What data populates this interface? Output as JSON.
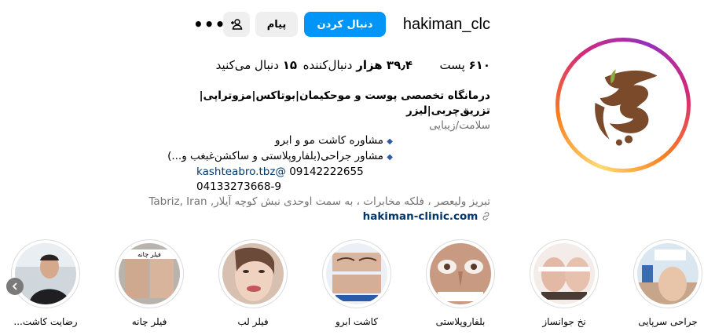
{
  "profile": {
    "username": "hakiman_clc",
    "follow_label": "دنبال کردن",
    "message_label": "پیام",
    "more_label": "•••",
    "stats": {
      "posts_value": "۶۱۰",
      "posts_label": "پست",
      "followers_value": "۳۹٫۴ هزار",
      "followers_label": "دنبال‌کننده",
      "following_value": "۱۵",
      "following_label": "دنبال می‌کنید"
    },
    "bio": {
      "name": "درمانگاه تخصصی پوست و موحکیمان|بوتاکس|مزوتراپی|تزریق‌چربی|لیزر",
      "category": "سلامت/زیبایی",
      "line1": "مشاوره کاشت مو و ابرو",
      "line2": "مشاور جراحی(بلفاروپلاستی و ساکشن‌غبغب و...)",
      "email": "kashteabro.tbz@",
      "phone1": "09142222655",
      "phone2": "04133273668-9",
      "address": "تبریز ولیعصر ، فلکه مخابرات ، به سمت اوحدی نبش کوچه آیلار, Tabriz, Iran",
      "website": "hakiman-clinic.com"
    },
    "colors": {
      "accent": "#0095f6",
      "brand_brown": "#7a4a2a"
    }
  },
  "highlights": [
    {
      "label": "جراحی سرپایی"
    },
    {
      "label": "نخ جوانساز"
    },
    {
      "label": "بلفاروپلاستی"
    },
    {
      "label": "کاشت ابرو"
    },
    {
      "label": "فیلر لب"
    },
    {
      "label": "فیلر چانه"
    },
    {
      "label": "رضایت کاشت..."
    }
  ],
  "highlight_overlay_text": {
    "chin": "فیلر چانه"
  },
  "icons": {
    "suggest": "person-add-icon",
    "website_link": "link-icon",
    "nav_prev": "chevron-left-icon"
  }
}
